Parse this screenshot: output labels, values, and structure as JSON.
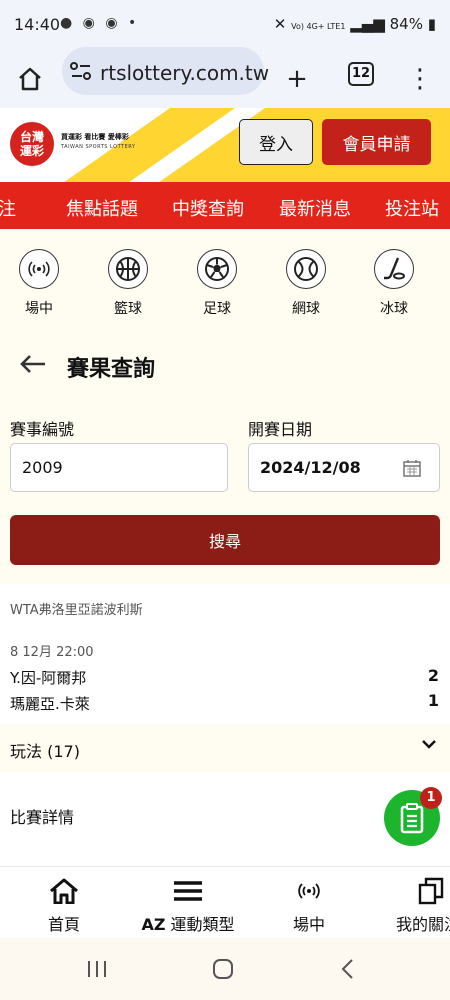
{
  "status_bar": {
    "time": "14:40",
    "network": "Vo) 4G+ LTE1",
    "battery": "84%"
  },
  "browser": {
    "url": "rtslottery.com.tw",
    "tabs_count": "12"
  },
  "header": {
    "logo_text": "台灣運彩",
    "logo_tagline": "買運彩 看比賽 愛棒彩",
    "logo_en": "TAIWAN SPORTS LOTTERY",
    "login_label": "登入",
    "register_label": "會員申請"
  },
  "nav": {
    "items": [
      "注",
      "焦點話題",
      "中獎查詢",
      "最新消息",
      "投注站"
    ]
  },
  "sports": {
    "items": [
      "場中",
      "籃球",
      "足球",
      "網球",
      "冰球"
    ]
  },
  "page": {
    "title": "賽果查詢"
  },
  "form": {
    "event_label": "賽事編號",
    "event_value": "2009",
    "date_label": "開賽日期",
    "date_value": "2024/12/08",
    "search_label": "搜尋"
  },
  "result": {
    "league": "WTA弗洛里亞諾波利斯",
    "time": "8 12月 22:00",
    "teams": [
      {
        "name": "Y.因-阿爾邦",
        "score": "2"
      },
      {
        "name": "瑪麗亞.卡萊",
        "score": "1"
      }
    ],
    "play_types": "玩法 (17)",
    "details": "比賽詳情"
  },
  "chat": {
    "badge": "1"
  },
  "bottom_nav": {
    "home": "首頁",
    "az": "AZ",
    "sports_type": "運動類型",
    "live": "場中",
    "mine": "我的關注"
  },
  "colors": {
    "brand_red": "#e3241b",
    "dark_red": "#8c1c16",
    "green": "#1db42e",
    "yellow": "#ffd531"
  }
}
